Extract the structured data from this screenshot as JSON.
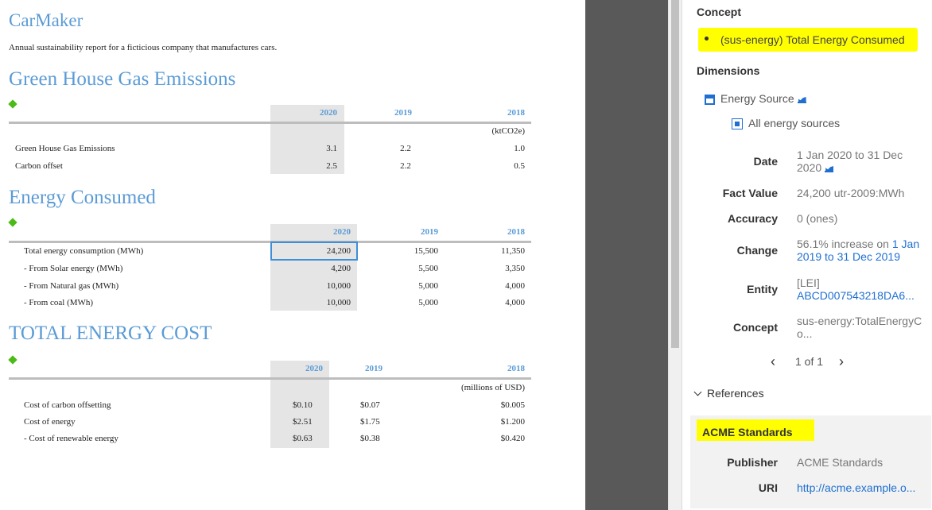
{
  "document": {
    "title": "CarMaker",
    "subtitle": "Annual sustainability report for a ficticious company that manufactures cars.",
    "ghg": {
      "heading": "Green House Gas Emissions",
      "years": [
        "2020",
        "2019",
        "2018"
      ],
      "unit": "(ktCO2e)",
      "rows": [
        {
          "label": "Green House Gas Emissions",
          "values": [
            "3.1",
            "2.2",
            "1.0"
          ]
        },
        {
          "label": "Carbon offset",
          "values": [
            "2.5",
            "2.2",
            "0.5"
          ]
        }
      ]
    },
    "energy": {
      "heading": "Energy Consumed",
      "years": [
        "2020",
        "2019",
        "2018"
      ],
      "rows": [
        {
          "label": "Total energy consumption (MWh)",
          "values": [
            "24,200",
            "15,500",
            "11,350"
          ]
        },
        {
          "label": "- From Solar energy (MWh)",
          "values": [
            "4,200",
            "5,500",
            "3,350"
          ]
        },
        {
          "label": "- From Natural gas (MWh)",
          "values": [
            "10,000",
            "5,000",
            "4,000"
          ]
        },
        {
          "label": "- From coal (MWh)",
          "values": [
            "10,000",
            "5,000",
            "4,000"
          ]
        }
      ]
    },
    "cost": {
      "heading": "TOTAL ENERGY COST",
      "years": [
        "2020",
        "2019",
        "2018"
      ],
      "unit": "(millions of USD)",
      "rows": [
        {
          "label": "Cost of carbon offsetting",
          "values": [
            "$0.10",
            "$0.07",
            "$0.005"
          ]
        },
        {
          "label": "Cost of energy",
          "values": [
            "$2.51",
            "$1.75",
            "$1.200"
          ]
        },
        {
          "label": "- Cost of renewable energy",
          "values": [
            "$0.63",
            "$0.38",
            "$0.420"
          ]
        }
      ]
    }
  },
  "inspector": {
    "concept_heading": "Concept",
    "concept_value": "(sus-energy) Total Energy Consumed",
    "dimensions_heading": "Dimensions",
    "dimension_name": "Energy Source",
    "dimension_member": "All energy sources",
    "fields": {
      "date_label": "Date",
      "date_value": "1 Jan 2020 to 31 Dec 2020",
      "fact_value_label": "Fact Value",
      "fact_value": "24,200 utr-2009:MWh",
      "accuracy_label": "Accuracy",
      "accuracy_value": "0 (ones)",
      "change_label": "Change",
      "change_prefix": "56.1% increase on ",
      "change_link": "1 Jan 2019 to 31 Dec 2019",
      "entity_label": "Entity",
      "entity_scheme": "[LEI]",
      "entity_value": "ABCD007543218DA6...",
      "concept_label": "Concept",
      "concept_value": "sus-energy:TotalEnergyCo..."
    },
    "pager": {
      "prev": "‹",
      "text": "1 of 1",
      "next": "›"
    },
    "references_heading": "References",
    "reference": {
      "title": "ACME Standards",
      "publisher_label": "Publisher",
      "publisher_value": "ACME Standards",
      "uri_label": "URI",
      "uri_value": "http://acme.example.o..."
    }
  },
  "colors": {
    "heading_blue": "#5b9bd5",
    "highlight": "#ffff00",
    "link": "#1f6fd1",
    "diamond": "#4cbb17"
  }
}
